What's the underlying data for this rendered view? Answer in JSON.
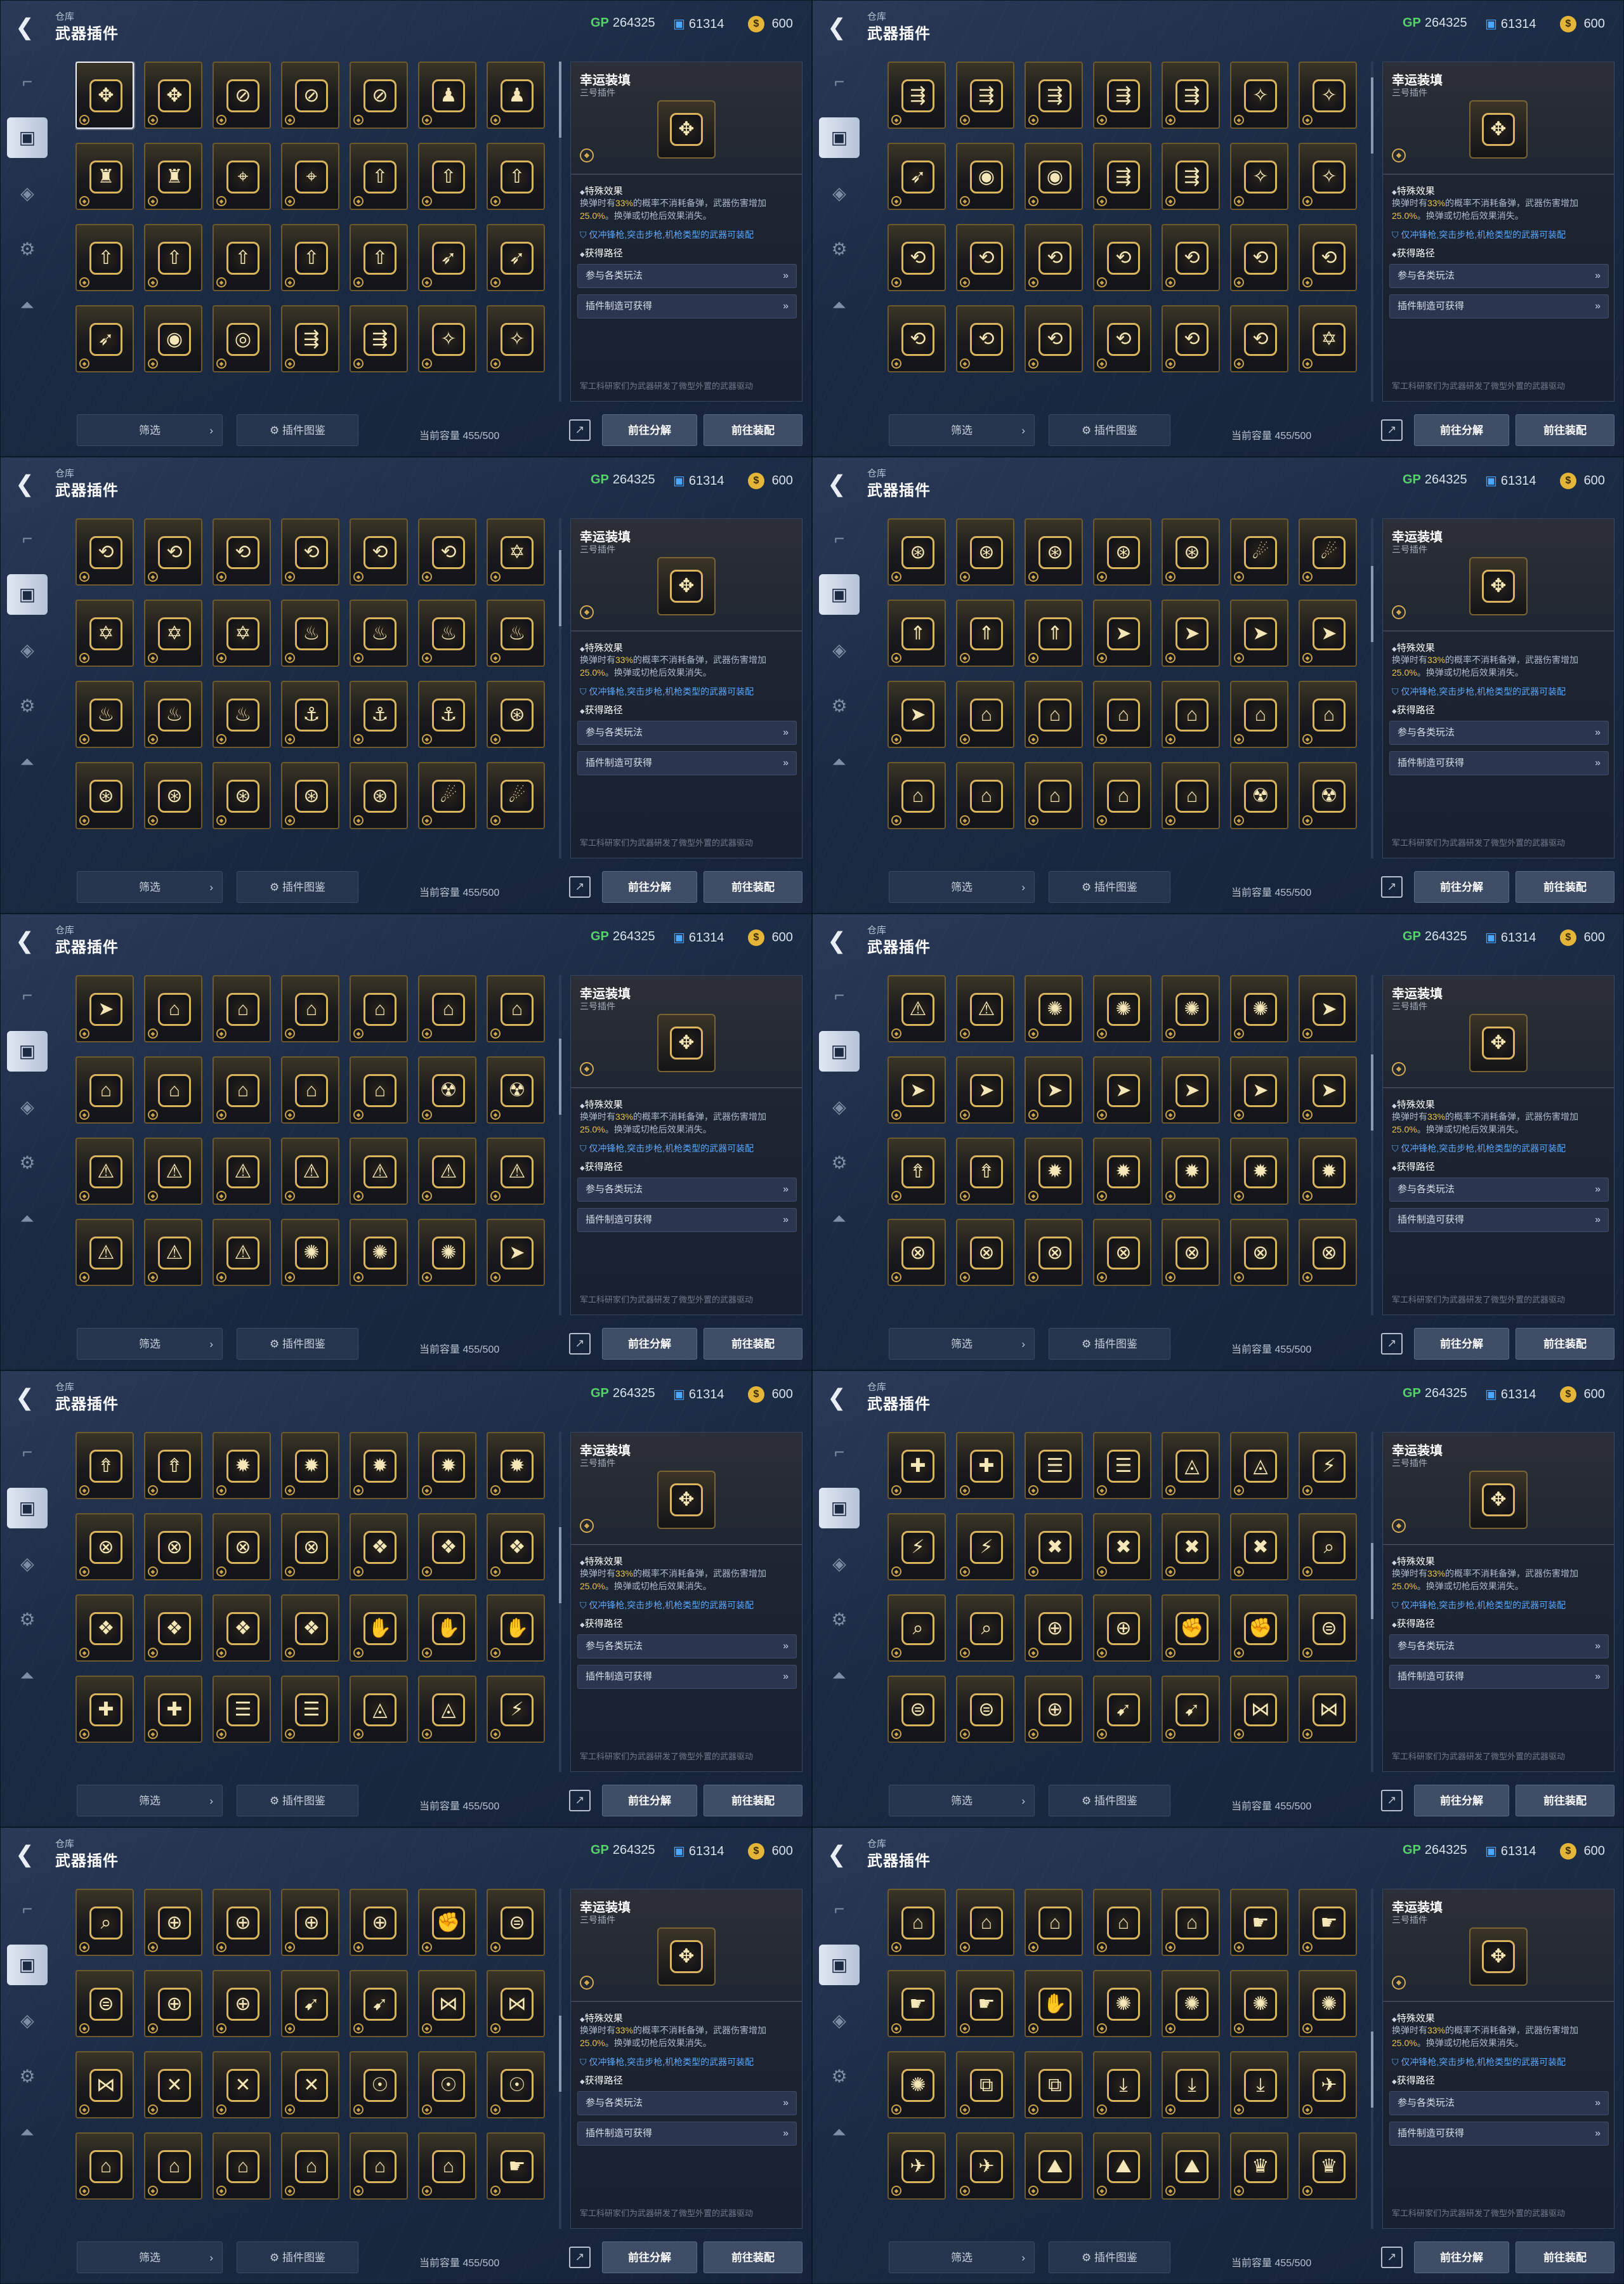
{
  "header": {
    "breadcrumb": "仓库",
    "title": "武器插件",
    "gp_label": "GP",
    "gp_value": "264325",
    "credit_value": "61314",
    "gold_value": "600"
  },
  "sidebar": {
    "items": [
      {
        "name": "weapon",
        "icon": "gun-icon"
      },
      {
        "name": "plugin",
        "icon": "chip-icon",
        "active": true
      },
      {
        "name": "ammo",
        "icon": "ammo-icon"
      },
      {
        "name": "attachment",
        "icon": "attachment-icon"
      },
      {
        "name": "skin",
        "icon": "emblem-icon"
      }
    ]
  },
  "detail": {
    "name": "幸运装填",
    "subtitle": "三号插件",
    "section_effect": "特殊效果",
    "effect_pre": "换弹时有",
    "effect_pct": "33%",
    "effect_mid": "的概率不消耗备弹，武器伤害增加",
    "effect_dmg": "25.0%",
    "effect_post": "。换弹或切枪后效果消失。",
    "limit": "仅冲锋枪,突击步枪,机枪类型的武器可装配",
    "section_source": "获得路径",
    "source_1": "参与各类玩法",
    "source_2": "插件制造可获得",
    "flavor": "军工科研家们为武器研发了微型外置的武器驱动"
  },
  "footer": {
    "filter": "筛选",
    "atlas": "插件图鉴",
    "capacity": "当前容量 455/500",
    "disassemble": "前往分解",
    "equip": "前往装配"
  },
  "panels": [
    {
      "scroll": 0.0,
      "first_selected": true,
      "icons": [
        "✥",
        "✥",
        "⊘",
        "⊘",
        "⊘",
        "♟",
        "♟",
        "♜",
        "♜",
        "⌖",
        "⌖",
        "⇧",
        "⇧",
        "⇧",
        "⇧",
        "⇧",
        "⇧",
        "⇧",
        "⇧",
        "➶",
        "➶",
        "➶",
        "◉",
        "◎",
        "⇶",
        "⇶",
        "✧",
        "✧"
      ]
    },
    {
      "scroll": 0.06,
      "first_selected": false,
      "icons": [
        "⇶",
        "⇶",
        "⇶",
        "⇶",
        "⇶",
        "✧",
        "✧",
        "➶",
        "◉",
        "◉",
        "⇶",
        "⇶",
        "✧",
        "✧",
        "⟲",
        "⟲",
        "⟲",
        "⟲",
        "⟲",
        "⟲",
        "⟲",
        "⟲",
        "⟲",
        "⟲",
        "⟲",
        "⟲",
        "⟲",
        "✡"
      ]
    },
    {
      "scroll": 0.12,
      "first_selected": false,
      "icons": [
        "⟲",
        "⟲",
        "⟲",
        "⟲",
        "⟲",
        "⟲",
        "✡",
        "✡",
        "✡",
        "✡",
        "♨",
        "♨",
        "♨",
        "♨",
        "♨",
        "♨",
        "♨",
        "⚓",
        "⚓",
        "⚓",
        "⊛",
        "⊛",
        "⊛",
        "⊛",
        "⊛",
        "⊛",
        "☄",
        "☄"
      ]
    },
    {
      "scroll": 0.18,
      "first_selected": false,
      "icons": [
        "⊛",
        "⊛",
        "⊛",
        "⊛",
        "⊛",
        "☄",
        "☄",
        "⇑",
        "⇑",
        "⇑",
        "➤",
        "➤",
        "➤",
        "➤",
        "➤",
        "⌂",
        "⌂",
        "⌂",
        "⌂",
        "⌂",
        "⌂",
        "⌂",
        "⌂",
        "⌂",
        "⌂",
        "⌂",
        "☢",
        "☢"
      ]
    },
    {
      "scroll": 0.24,
      "first_selected": false,
      "icons": [
        "➤",
        "⌂",
        "⌂",
        "⌂",
        "⌂",
        "⌂",
        "⌂",
        "⌂",
        "⌂",
        "⌂",
        "⌂",
        "⌂",
        "☢",
        "☢",
        "⚠",
        "⚠",
        "⚠",
        "⚠",
        "⚠",
        "⚠",
        "⚠",
        "⚠",
        "⚠",
        "⚠",
        "✺",
        "✺",
        "✺",
        "➤"
      ]
    },
    {
      "scroll": 0.3,
      "first_selected": false,
      "icons": [
        "⚠",
        "⚠",
        "✺",
        "✺",
        "✺",
        "✺",
        "➤",
        "➤",
        "➤",
        "➤",
        "➤",
        "➤",
        "➤",
        "➤",
        "⇮",
        "⇮",
        "✹",
        "✹",
        "✹",
        "✹",
        "✹",
        "⊗",
        "⊗",
        "⊗",
        "⊗",
        "⊗",
        "⊗",
        "⊗"
      ]
    },
    {
      "scroll": 0.36,
      "first_selected": false,
      "icons": [
        "⇮",
        "⇮",
        "✹",
        "✹",
        "✹",
        "✹",
        "✹",
        "⊗",
        "⊗",
        "⊗",
        "⊗",
        "❖",
        "❖",
        "❖",
        "❖",
        "❖",
        "❖",
        "❖",
        "✋",
        "✋",
        "✋",
        "✚",
        "✚",
        "☰",
        "☰",
        "◬",
        "◬",
        "⚡"
      ]
    },
    {
      "scroll": 0.42,
      "first_selected": false,
      "icons": [
        "✚",
        "✚",
        "☰",
        "☰",
        "◬",
        "◬",
        "⚡",
        "⚡",
        "⚡",
        "✖",
        "✖",
        "✖",
        "✖",
        "⌕",
        "⌕",
        "⌕",
        "⊕",
        "⊕",
        "✊",
        "✊",
        "⊜",
        "⊜",
        "⊜",
        "⊕",
        "➹",
        "➹",
        "⋈",
        "⋈"
      ]
    },
    {
      "scroll": 0.48,
      "first_selected": false,
      "icons": [
        "⌕",
        "⊕",
        "⊕",
        "⊕",
        "⊕",
        "✊",
        "⊜",
        "⊜",
        "⊕",
        "⊕",
        "➹",
        "➹",
        "⋈",
        "⋈",
        "⋈",
        "✕",
        "✕",
        "✕",
        "☉",
        "☉",
        "☉",
        "⌂",
        "⌂",
        "⌂",
        "⌂",
        "⌂",
        "⌂",
        "☛"
      ]
    },
    {
      "scroll": 0.54,
      "first_selected": false,
      "icons": [
        "⌂",
        "⌂",
        "⌂",
        "⌂",
        "⌂",
        "☛",
        "☛",
        "☛",
        "☛",
        "✋",
        "✺",
        "✺",
        "✺",
        "✺",
        "✺",
        "⧉",
        "⧉",
        "⤓",
        "⤓",
        "⤓",
        "✈",
        "✈",
        "✈",
        "⛰",
        "⛰",
        "⛰",
        "♛",
        "♛"
      ]
    }
  ]
}
